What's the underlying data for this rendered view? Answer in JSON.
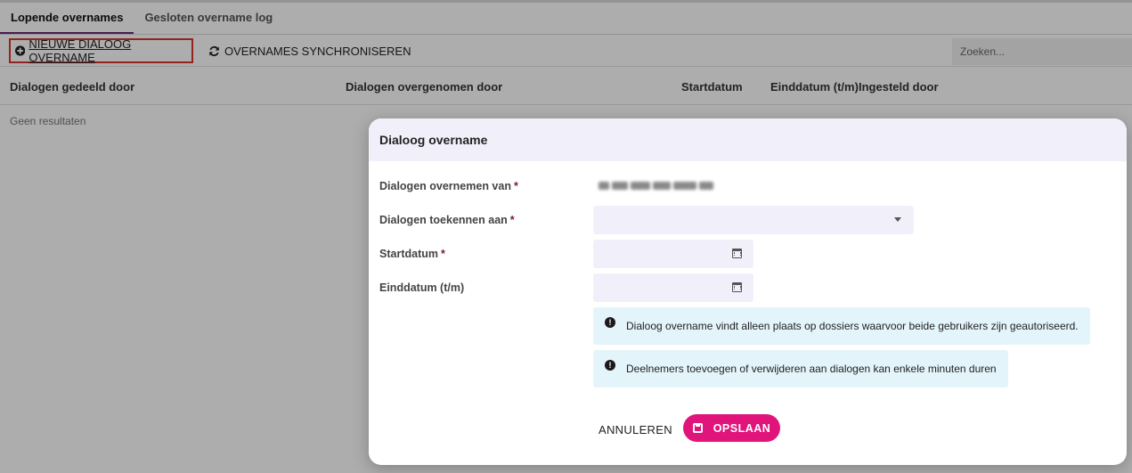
{
  "tabs": [
    {
      "label": "Lopende overnames"
    },
    {
      "label": "Gesloten overname log"
    }
  ],
  "toolbar": {
    "new_label": "NIEUWE DIALOOG OVERNAME",
    "sync_label": "OVERNAMES SYNCHRONISEREN",
    "search_placeholder": "Zoeken..."
  },
  "table": {
    "columns": [
      "Dialogen gedeeld door",
      "Dialogen overgenomen door",
      "Startdatum",
      "Einddatum (t/m)",
      "Ingesteld door"
    ],
    "empty_text": "Geen resultaten"
  },
  "dialog": {
    "title": "Dialoog overname",
    "fields": [
      {
        "label": "Dialogen overnemen van",
        "required": "*"
      },
      {
        "label": "Dialogen toekennen aan",
        "required": "*"
      },
      {
        "label": "Startdatum",
        "required": "*"
      },
      {
        "label": "Einddatum (t/m)",
        "required": ""
      }
    ],
    "notes": [
      "Dialoog overname vindt alleen plaats op dossiers waarvoor beide gebruikers zijn geautoriseerd.",
      "Deelnemers toevoegen of verwijderen aan dialogen kan enkele minuten duren"
    ],
    "cancel_label": "ANNULEREN",
    "save_label": "OPSLAAN"
  },
  "icons": {
    "new": "plus-circle-icon",
    "sync": "sync-icon",
    "calendar": "calendar-icon",
    "info": "info-icon",
    "save": "floppy-disk-icon"
  },
  "colors": {
    "accent": "#e0147a",
    "tab_active": "#6b2a7a",
    "highlight_border": "#d9342b",
    "field_bg": "#f1f0fa",
    "note_bg": "#e4f4fb"
  }
}
